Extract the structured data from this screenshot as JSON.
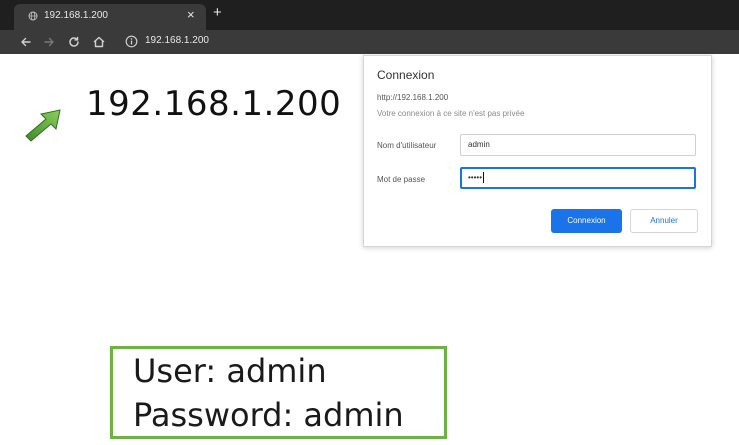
{
  "browser": {
    "tab": {
      "title": "192.168.1.200",
      "close_icon": "close-icon"
    },
    "new_tab_icon": "plus-icon",
    "address": "192.168.1.200"
  },
  "content": {
    "ip_heading": "192.168.1.200",
    "arrow_icon": "green-arrow-icon",
    "accent": "#6cb33f"
  },
  "auth_dialog": {
    "title": "Connexion",
    "url": "http://192.168.1.200",
    "note": "Votre connexion à ce site n'est pas privée",
    "username": {
      "label": "Nom d'utilisateur",
      "value": "admin"
    },
    "password": {
      "label": "Mot de passe",
      "value": "•••••"
    },
    "submit_label": "Connexion",
    "cancel_label": "Annuler",
    "primary_color": "#1a73e8"
  },
  "credentials": {
    "user_line": "User: admin",
    "password_line": "Password: admin"
  }
}
